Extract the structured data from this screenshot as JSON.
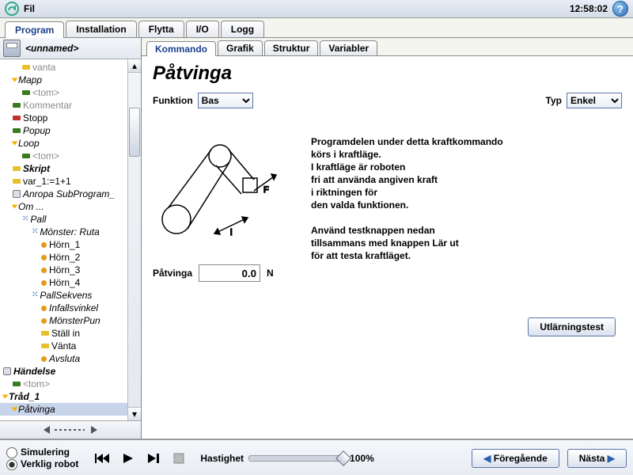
{
  "topbar": {
    "menu": "Fil",
    "clock": "12:58:02",
    "help": "?"
  },
  "main_tabs": [
    "Program",
    "Installation",
    "Flytta",
    "I/O",
    "Logg"
  ],
  "main_tab_active": 0,
  "program_title": "<unnamed>",
  "tree": [
    {
      "indent": 2,
      "icon": "bar-y",
      "text": "vanta",
      "muted": true
    },
    {
      "indent": 1,
      "icon": "tri",
      "text": "Mapp",
      "italic": true
    },
    {
      "indent": 2,
      "icon": "bar-g",
      "text": "<tom>",
      "muted": true
    },
    {
      "indent": 1,
      "icon": "bar-g",
      "text": "Kommentar",
      "muted": true
    },
    {
      "indent": 1,
      "icon": "bar-r",
      "text": "Stopp"
    },
    {
      "indent": 1,
      "icon": "bar-g",
      "text": "Popup",
      "italic": true
    },
    {
      "indent": 1,
      "icon": "tri",
      "text": "Loop",
      "italic": true
    },
    {
      "indent": 2,
      "icon": "bar-g",
      "text": "<tom>",
      "muted": true
    },
    {
      "indent": 1,
      "icon": "bar-y",
      "text": "Skript",
      "bold": true,
      "italic": true
    },
    {
      "indent": 1,
      "icon": "bar-y",
      "text": "var_1:=1+1"
    },
    {
      "indent": 1,
      "icon": "link",
      "text": "Anropa SubProgram_",
      "italic": true
    },
    {
      "indent": 1,
      "icon": "tri",
      "text": "Om ...",
      "italic": true
    },
    {
      "indent": 2,
      "icon": "key9",
      "text": "Pall",
      "italic": true
    },
    {
      "indent": 3,
      "icon": "key9",
      "text": "Mönster: Ruta",
      "italic": true
    },
    {
      "indent": 4,
      "icon": "dot-o",
      "text": "Hörn_1"
    },
    {
      "indent": 4,
      "icon": "dot-o",
      "text": "Hörn_2"
    },
    {
      "indent": 4,
      "icon": "dot-o",
      "text": "Hörn_3"
    },
    {
      "indent": 4,
      "icon": "dot-o",
      "text": "Hörn_4"
    },
    {
      "indent": 3,
      "icon": "key9",
      "text": "PallSekvens",
      "italic": true
    },
    {
      "indent": 4,
      "icon": "dot-o",
      "text": "Infallsvinkel",
      "italic": true
    },
    {
      "indent": 4,
      "icon": "dot-o",
      "text": "MönsterPun",
      "italic": true
    },
    {
      "indent": 4,
      "icon": "bar-y",
      "text": "Ställ in"
    },
    {
      "indent": 4,
      "icon": "bar-y",
      "text": "Vänta"
    },
    {
      "indent": 4,
      "icon": "dot-o",
      "text": "Avsluta",
      "italic": true
    },
    {
      "indent": 0,
      "icon": "link",
      "text": "Händelse",
      "bold": true,
      "italic": true
    },
    {
      "indent": 1,
      "icon": "bar-g",
      "text": "<tom>",
      "muted": true
    },
    {
      "indent": 0,
      "icon": "tri",
      "text": "Tråd_1",
      "bold": true,
      "italic": true
    },
    {
      "indent": 1,
      "icon": "tri",
      "text": "Påtvinga",
      "italic": true,
      "sel": true
    }
  ],
  "sub_tabs": [
    "Kommando",
    "Grafik",
    "Struktur",
    "Variabler"
  ],
  "sub_tab_active": 0,
  "panel": {
    "title": "Påtvinga",
    "funktion_label": "Funktion",
    "funktion_value": "Bas",
    "typ_label": "Typ",
    "typ_value": "Enkel",
    "desc_lines": [
      "Programdelen under detta kraftkommando",
      "körs i kraftläge.",
      "I kraftläge är roboten",
      "fri att använda angiven kraft",
      "i riktningen för",
      "den valda funktionen.",
      "",
      "Använd testknappen nedan",
      "tillsammans med knappen Lär ut",
      "för att testa kraftläget."
    ],
    "force_label": "Påtvinga",
    "force_value": "0.0",
    "force_unit": "N",
    "test_button": "Utlärningstest"
  },
  "footer": {
    "sim": "Simulering",
    "real": "Verklig robot",
    "speed_label": "Hastighet",
    "speed_value": "100%",
    "prev": "Föregående",
    "next": "Nästa"
  }
}
